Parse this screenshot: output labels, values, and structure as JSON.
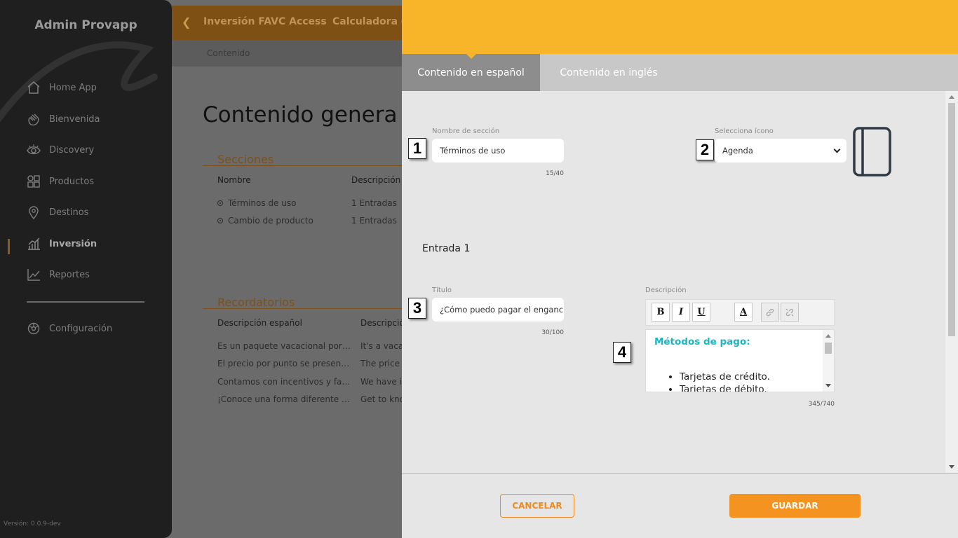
{
  "app": {
    "brand": "Admin Provapp",
    "version": "Versión: 0.0.9-dev"
  },
  "sidebar": {
    "items": [
      {
        "label": "Home App",
        "icon": "home-icon"
      },
      {
        "label": "Bienvenida",
        "icon": "wave-hand-icon"
      },
      {
        "label": "Discovery",
        "icon": "eye-icon"
      },
      {
        "label": "Productos",
        "icon": "grid-icon"
      },
      {
        "label": "Destinos",
        "icon": "location-pin-icon"
      },
      {
        "label": "Inversión",
        "icon": "bar-chart-icon",
        "active": true
      },
      {
        "label": "Reportes",
        "icon": "line-chart-icon"
      },
      {
        "label": "Configuración",
        "icon": "gear-icon"
      }
    ]
  },
  "background": {
    "topbar": {
      "title1": "Inversión FAVC Access",
      "title2": "Calculadora d"
    },
    "breadcrumb": "Contenido",
    "page_title": "Contenido genera",
    "sections": {
      "title": "Secciones",
      "col_name": "Nombre",
      "col_desc": "Descripción",
      "rows": [
        {
          "name": "Términos de uso",
          "desc": "1 Entradas"
        },
        {
          "name": "Cambio de producto",
          "desc": "1 Entradas"
        }
      ]
    },
    "reminders": {
      "title": "Recordatorios",
      "col_es": "Descripción español",
      "col_en": "Descripció",
      "rows": [
        {
          "es": "Es un paquete vacacional por…",
          "en": "It's a vaca"
        },
        {
          "es": "El precio por punto se presen…",
          "en": "The price p"
        },
        {
          "es": "Contamos con incentivos y fa…",
          "en": "We have in"
        },
        {
          "es": "¡Conoce una forma diferente …",
          "en": "Get to kno"
        }
      ]
    }
  },
  "panel": {
    "tabs": [
      {
        "label": "Contenido en español",
        "active": true
      },
      {
        "label": "Contenido en inglés",
        "active": false
      }
    ],
    "section_name": {
      "label": "Nombre de sección",
      "value": "Términos de uso",
      "counter": "15/40",
      "marker": "1"
    },
    "icon_select": {
      "label": "Selecciona ícono",
      "value": "Agenda",
      "marker": "2",
      "preview_icon": "agenda-book-icon"
    },
    "entry_title": "Entrada 1",
    "title_field": {
      "label": "Título",
      "value": "¿Cómo puedo pagar el engancl",
      "counter": "30/100",
      "marker": "3"
    },
    "description": {
      "label": "Descripción",
      "marker": "4",
      "toolbar": {
        "bold": "B",
        "italic": "I",
        "underline": "U",
        "color": "A"
      },
      "heading": "Métodos de pago:",
      "list": [
        "Tarjetas de crédito.",
        "Tarjetas de débito."
      ],
      "counter": "345/740",
      "heading_color": "#1bb8c4"
    },
    "buttons": {
      "cancel": "CANCELAR",
      "save": "GUARDAR"
    },
    "colors": {
      "accent": "#f8b52a",
      "button": "#f59320",
      "cancel": "#f08a1c"
    }
  }
}
